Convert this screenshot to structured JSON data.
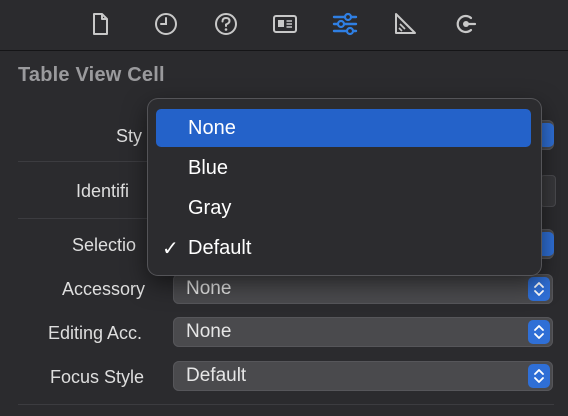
{
  "toolbar": {
    "icons": [
      "file-inspector-icon",
      "history-inspector-icon",
      "help-inspector-icon",
      "identity-inspector-icon",
      "attributes-inspector-icon",
      "size-inspector-icon",
      "connections-inspector-icon"
    ],
    "active": "attributes-inspector-icon",
    "active_color": "#2f7fe3"
  },
  "section": {
    "title": "Table View Cell"
  },
  "rows": {
    "style_label": "Sty",
    "identifier_label": "Identifi",
    "selection_label": "Selectio",
    "accessory_label": "Accessory",
    "accessory_value": "None",
    "editing_label": "Editing Acc.",
    "editing_value": "None",
    "focus_label": "Focus Style",
    "focus_value": "Default"
  },
  "menu": {
    "items": [
      {
        "label": "None",
        "selected": true,
        "checked": false
      },
      {
        "label": "Blue",
        "selected": false,
        "checked": false
      },
      {
        "label": "Gray",
        "selected": false,
        "checked": false
      },
      {
        "label": "Default",
        "selected": false,
        "checked": true
      }
    ],
    "check_glyph": "✓"
  },
  "colors": {
    "highlight": "#2462c9",
    "stepper": "#2f6fd6"
  }
}
